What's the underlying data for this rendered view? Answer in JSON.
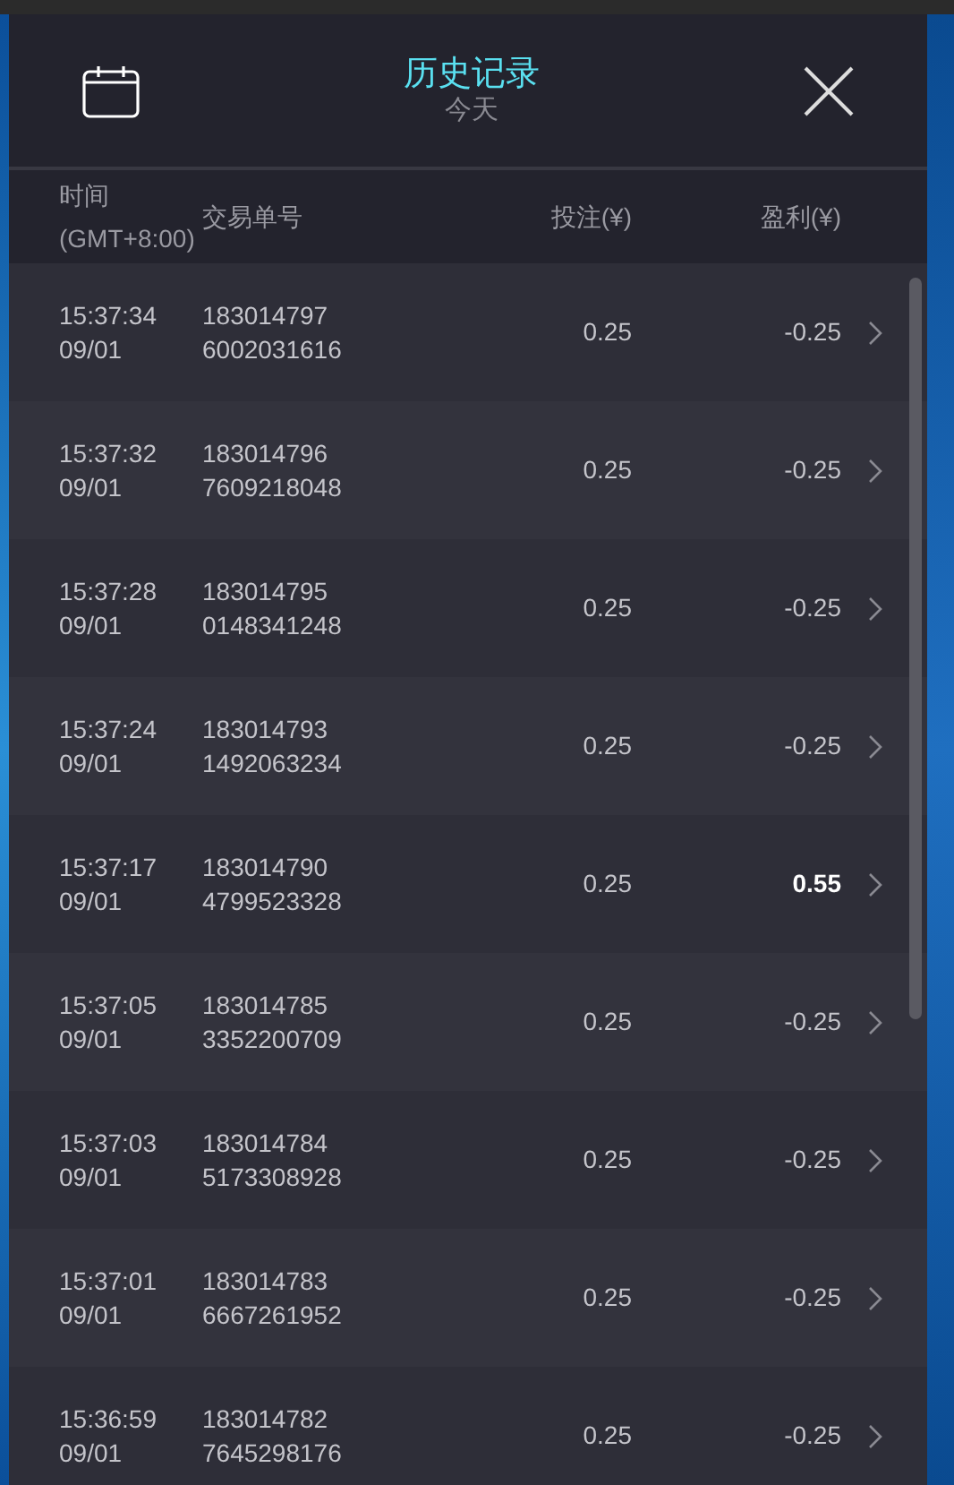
{
  "header": {
    "title": "历史记录",
    "subtitle": "今天"
  },
  "columns": {
    "time": "时间",
    "timezone": "(GMT+8:00)",
    "order": "交易单号",
    "stake": "投注(¥)",
    "profit": "盈利(¥)"
  },
  "rows": [
    {
      "time": "15:37:34",
      "date": "09/01",
      "order_1": "183014797",
      "order_2": "6002031616",
      "stake": "0.25",
      "profit": "-0.25",
      "win": false
    },
    {
      "time": "15:37:32",
      "date": "09/01",
      "order_1": "183014796",
      "order_2": "7609218048",
      "stake": "0.25",
      "profit": "-0.25",
      "win": false
    },
    {
      "time": "15:37:28",
      "date": "09/01",
      "order_1": "183014795",
      "order_2": "0148341248",
      "stake": "0.25",
      "profit": "-0.25",
      "win": false
    },
    {
      "time": "15:37:24",
      "date": "09/01",
      "order_1": "183014793",
      "order_2": "1492063234",
      "stake": "0.25",
      "profit": "-0.25",
      "win": false
    },
    {
      "time": "15:37:17",
      "date": "09/01",
      "order_1": "183014790",
      "order_2": "4799523328",
      "stake": "0.25",
      "profit": "0.55",
      "win": true
    },
    {
      "time": "15:37:05",
      "date": "09/01",
      "order_1": "183014785",
      "order_2": "3352200709",
      "stake": "0.25",
      "profit": "-0.25",
      "win": false
    },
    {
      "time": "15:37:03",
      "date": "09/01",
      "order_1": "183014784",
      "order_2": "5173308928",
      "stake": "0.25",
      "profit": "-0.25",
      "win": false
    },
    {
      "time": "15:37:01",
      "date": "09/01",
      "order_1": "183014783",
      "order_2": "6667261952",
      "stake": "0.25",
      "profit": "-0.25",
      "win": false
    },
    {
      "time": "15:36:59",
      "date": "09/01",
      "order_1": "183014782",
      "order_2": "7645298176",
      "stake": "0.25",
      "profit": "-0.25",
      "win": false
    }
  ]
}
